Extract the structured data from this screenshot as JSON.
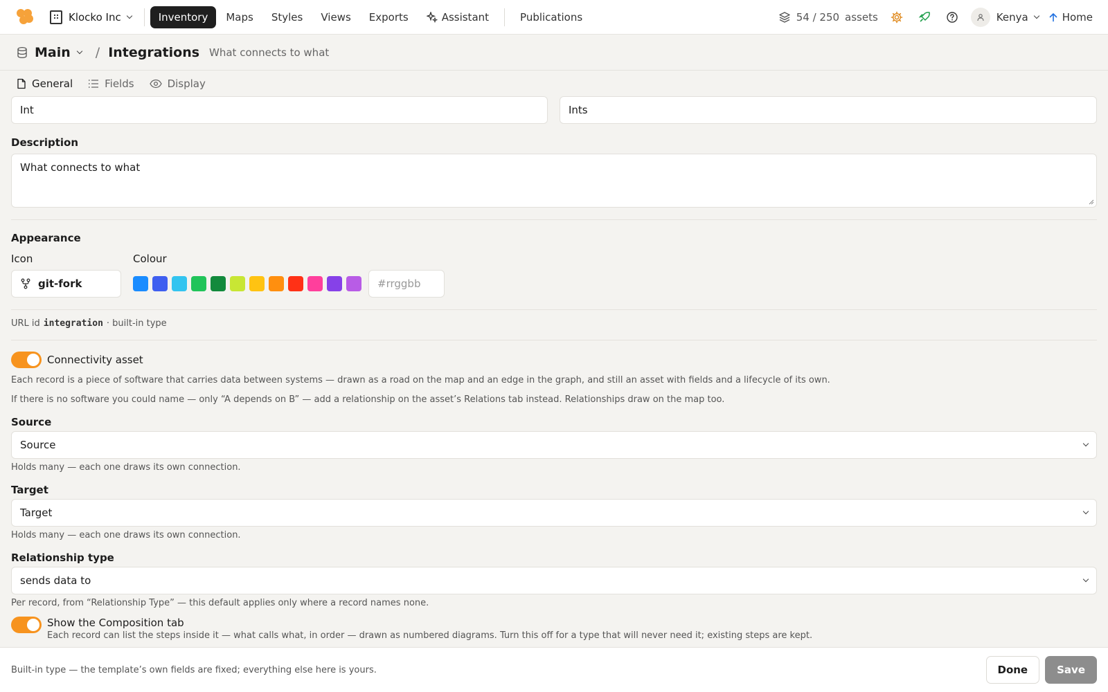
{
  "topbar": {
    "org_name": "Klocko Inc",
    "nav": [
      {
        "label": "Inventory",
        "active": true
      },
      {
        "label": "Maps"
      },
      {
        "label": "Styles"
      },
      {
        "label": "Views"
      },
      {
        "label": "Exports"
      },
      {
        "label": "Assistant"
      },
      {
        "label": "Publications"
      }
    ],
    "assets_count": "54 / 250",
    "assets_label": "assets",
    "user_name": "Kenya",
    "home_label": "Home"
  },
  "breadcrumb": {
    "root": "Main",
    "separator": "/",
    "title": "Integrations",
    "subtitle": "What connects to what"
  },
  "tabs": [
    {
      "label": "General",
      "icon": "file-icon",
      "active": true
    },
    {
      "label": "Fields",
      "icon": "list-icon"
    },
    {
      "label": "Display",
      "icon": "eye-icon"
    }
  ],
  "form": {
    "singular_value": "Int",
    "plural_value": "Ints",
    "description_label": "Description",
    "description_value": "What connects to what",
    "appearance_label": "Appearance",
    "icon_label": "Icon",
    "icon_value": "git-fork",
    "colour_label": "Colour",
    "colours": [
      "#1a8cff",
      "#3f5ff0",
      "#33c4f0",
      "#21c45a",
      "#128a3c",
      "#c8e634",
      "#ffc312",
      "#ff8f0f",
      "#ff3116",
      "#ff3f9c",
      "#8641e8",
      "#b85ce6"
    ],
    "hex_placeholder": "#rrggbb",
    "url_id_prefix": "URL id",
    "url_id_value": "integration",
    "url_id_suffix": "· built-in type",
    "connectivity_label": "Connectivity asset",
    "connectivity_on": true,
    "connectivity_help_1": "Each record is a piece of software that carries data between systems — drawn as a road on the map and an edge in the graph, and still an asset with fields and a lifecycle of its own.",
    "connectivity_help_2": "If there is no software you could name — only “A depends on B” — add a relationship on the asset’s Relations tab instead. Relationships draw on the map too.",
    "source_label": "Source",
    "source_value": "Source",
    "source_help": "Holds many — each one draws its own connection.",
    "target_label": "Target",
    "target_value": "Target",
    "target_help": "Holds many — each one draws its own connection.",
    "reltype_label": "Relationship type",
    "reltype_value": "sends data to",
    "reltype_help": "Per record, from “Relationship Type” — this default applies only where a record names none.",
    "composition_label": "Show the Composition tab",
    "composition_on": true,
    "composition_help": "Each record can list the steps inside it — what calls what, in order — drawn as numbered diagrams. Turn this off for a type that will never need it; existing steps are kept."
  },
  "footer": {
    "note": "Built-in type — the template’s own fields are fixed; everything else here is yours.",
    "done_label": "Done",
    "save_label": "Save"
  }
}
